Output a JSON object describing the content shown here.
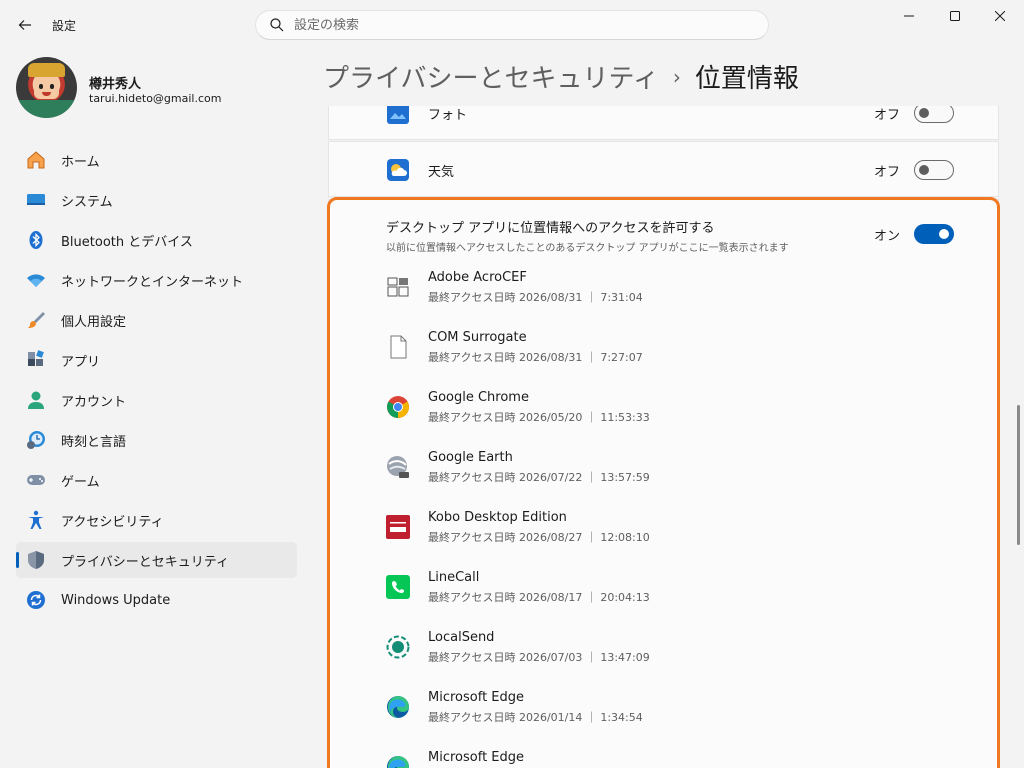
{
  "window": {
    "title": "設定",
    "controls": {
      "minimize": "minimize-icon",
      "maximize": "maximize-icon",
      "close": "close-icon"
    }
  },
  "search": {
    "placeholder": "設定の検索"
  },
  "user": {
    "name": "樽井秀人",
    "email": "tarui.hideto@gmail.com"
  },
  "sidebar": {
    "items": [
      {
        "label": "ホーム",
        "icon": "home-icon"
      },
      {
        "label": "システム",
        "icon": "system-icon"
      },
      {
        "label": "Bluetooth とデバイス",
        "icon": "bluetooth-icon"
      },
      {
        "label": "ネットワークとインターネット",
        "icon": "wifi-icon"
      },
      {
        "label": "個人用設定",
        "icon": "brush-icon"
      },
      {
        "label": "アプリ",
        "icon": "apps-icon"
      },
      {
        "label": "アカウント",
        "icon": "account-icon"
      },
      {
        "label": "時刻と言語",
        "icon": "time-language-icon"
      },
      {
        "label": "ゲーム",
        "icon": "gamepad-icon"
      },
      {
        "label": "アクセシビリティ",
        "icon": "accessibility-icon"
      },
      {
        "label": "プライバシーとセキュリティ",
        "icon": "shield-icon",
        "active": true
      },
      {
        "label": "Windows Update",
        "icon": "windows-update-icon"
      }
    ]
  },
  "header": {
    "breadcrumb_parent": "プライバシーとセキュリティ",
    "separator": "›",
    "title": "位置情報"
  },
  "rows": [
    {
      "label": "フォト",
      "state": "オフ",
      "on": false,
      "icon": "photos-icon"
    },
    {
      "label": "天気",
      "state": "オフ",
      "on": false,
      "icon": "weather-icon"
    }
  ],
  "desktop_apps": {
    "title": "デスクトップ アプリに位置情報へのアクセスを許可する",
    "subtitle": "以前に位置情報へアクセスしたことのあるデスクトップ アプリがここに一覧表示されます",
    "state": "オン",
    "on": true,
    "apps": [
      {
        "name": "Adobe AcroCEF",
        "access": "最終アクセス日時 2026/08/31 ｜ 7:31:04",
        "icon": "acrocef-icon"
      },
      {
        "name": "COM Surrogate",
        "access": "最終アクセス日時 2026/08/31 ｜ 7:27:07",
        "icon": "file-icon"
      },
      {
        "name": "Google Chrome",
        "access": "最終アクセス日時 2026/05/20 ｜ 11:53:33",
        "icon": "chrome-icon"
      },
      {
        "name": "Google Earth",
        "access": "最終アクセス日時 2026/07/22 ｜ 13:57:59",
        "icon": "google-earth-icon"
      },
      {
        "name": "Kobo Desktop Edition",
        "access": "最終アクセス日時 2026/08/27 ｜ 12:08:10",
        "icon": "kobo-icon"
      },
      {
        "name": "LineCall",
        "access": "最終アクセス日時 2026/08/17 ｜ 20:04:13",
        "icon": "linecall-icon"
      },
      {
        "name": "LocalSend",
        "access": "最終アクセス日時 2026/07/03 ｜ 13:47:09",
        "icon": "localsend-icon"
      },
      {
        "name": "Microsoft Edge",
        "access": "最終アクセス日時 2026/01/14 ｜ 1:34:54",
        "icon": "edge-icon"
      },
      {
        "name": "Microsoft Edge",
        "access": "",
        "icon": "edge-icon"
      }
    ]
  },
  "colors": {
    "accent": "#005fb8",
    "highlight": "#f07820",
    "background": "#f3f3f3",
    "card": "#fbfbfb"
  }
}
